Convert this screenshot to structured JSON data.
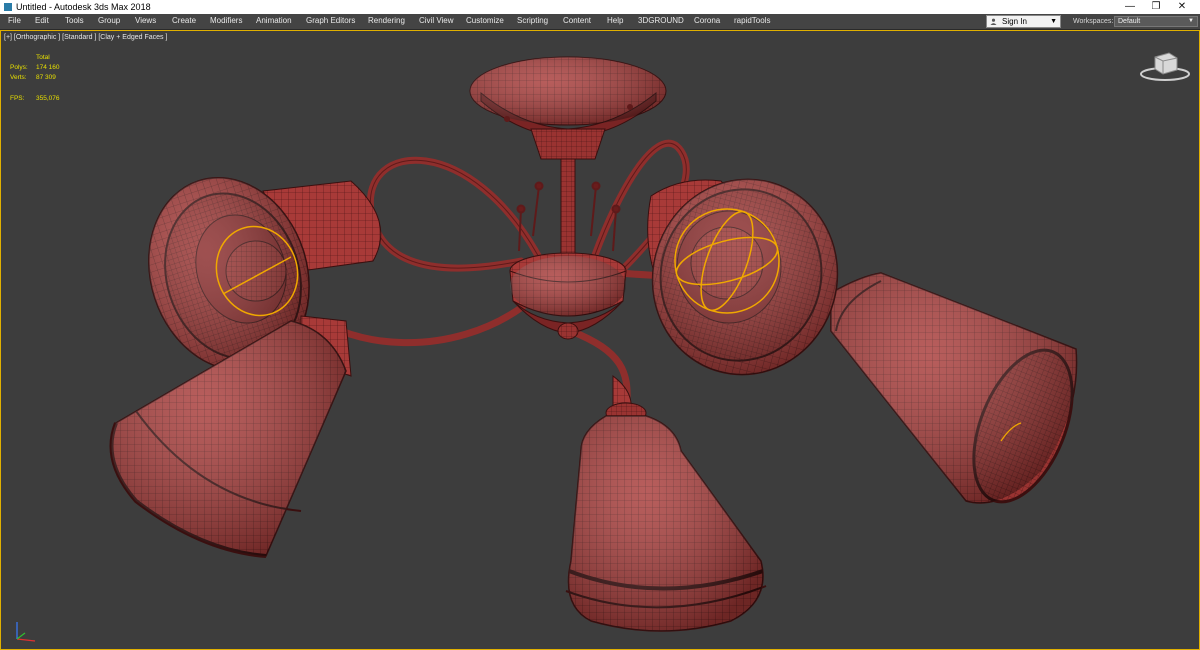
{
  "window": {
    "title": "Untitled - Autodesk 3ds Max 2018",
    "controls": {
      "minimize": "—",
      "maximize": "❐",
      "close": "✕"
    }
  },
  "menubar": {
    "items": [
      "File",
      "Edit",
      "Tools",
      "Group",
      "Views",
      "Create",
      "Modifiers",
      "Animation",
      "Graph Editors",
      "Rendering",
      "Civil View",
      "Customize",
      "Scripting",
      "Content",
      "Help",
      "3DGROUND",
      "Corona",
      "rapidTools"
    ],
    "signin_label": "Sign In",
    "workspaces_label": "Workspaces:",
    "workspaces_value": "Default"
  },
  "viewport": {
    "label": "[+] [Orthographic ] [Standard ] [Clay + Edged Faces ]",
    "stats": {
      "header": "Total",
      "polys_label": "Polys:",
      "polys_value": "174 160",
      "verts_label": "Verts:",
      "verts_value": "87 309",
      "fps_label": "FPS:",
      "fps_value": "355,076"
    }
  },
  "colors": {
    "model": "#a83a38",
    "model_dark": "#5e1a1a",
    "selection": "#f0a800",
    "viewport_bg": "#3d3d3d",
    "active_border": "#e0b000"
  },
  "icons": [
    "app-icon",
    "user-icon",
    "chevron-down-icon",
    "viewcube-icon",
    "axis-tripod-icon"
  ]
}
